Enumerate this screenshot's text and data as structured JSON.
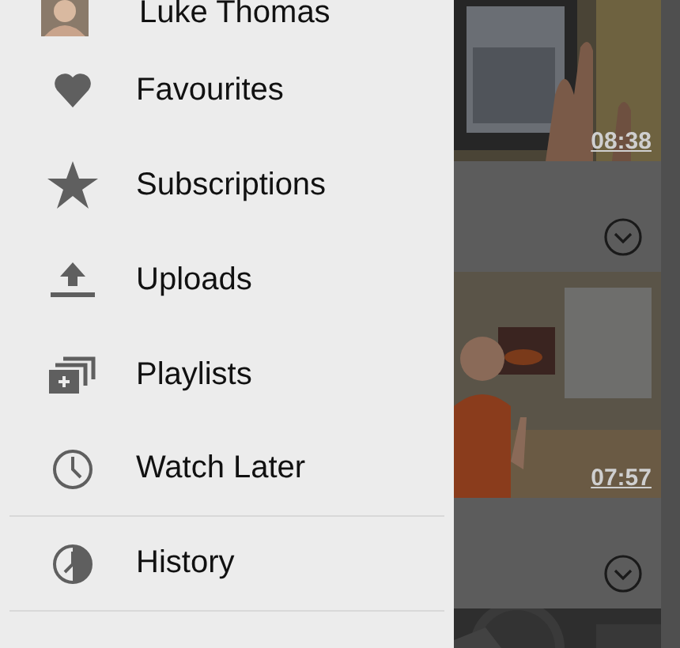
{
  "drawer": {
    "profile": {
      "name": "Luke Thomas"
    },
    "items": [
      {
        "label": "Favourites",
        "kind": "heart"
      },
      {
        "label": "Subscriptions",
        "kind": "star"
      },
      {
        "label": "Uploads",
        "kind": "upload"
      },
      {
        "label": "Playlists",
        "kind": "playlist"
      },
      {
        "label": "Watch Later",
        "kind": "clock"
      },
      {
        "label": "History",
        "kind": "history"
      }
    ]
  },
  "videos": [
    {
      "duration": "08:38",
      "kind": "picture"
    },
    {
      "duration": "07:57",
      "kind": "picture"
    }
  ]
}
